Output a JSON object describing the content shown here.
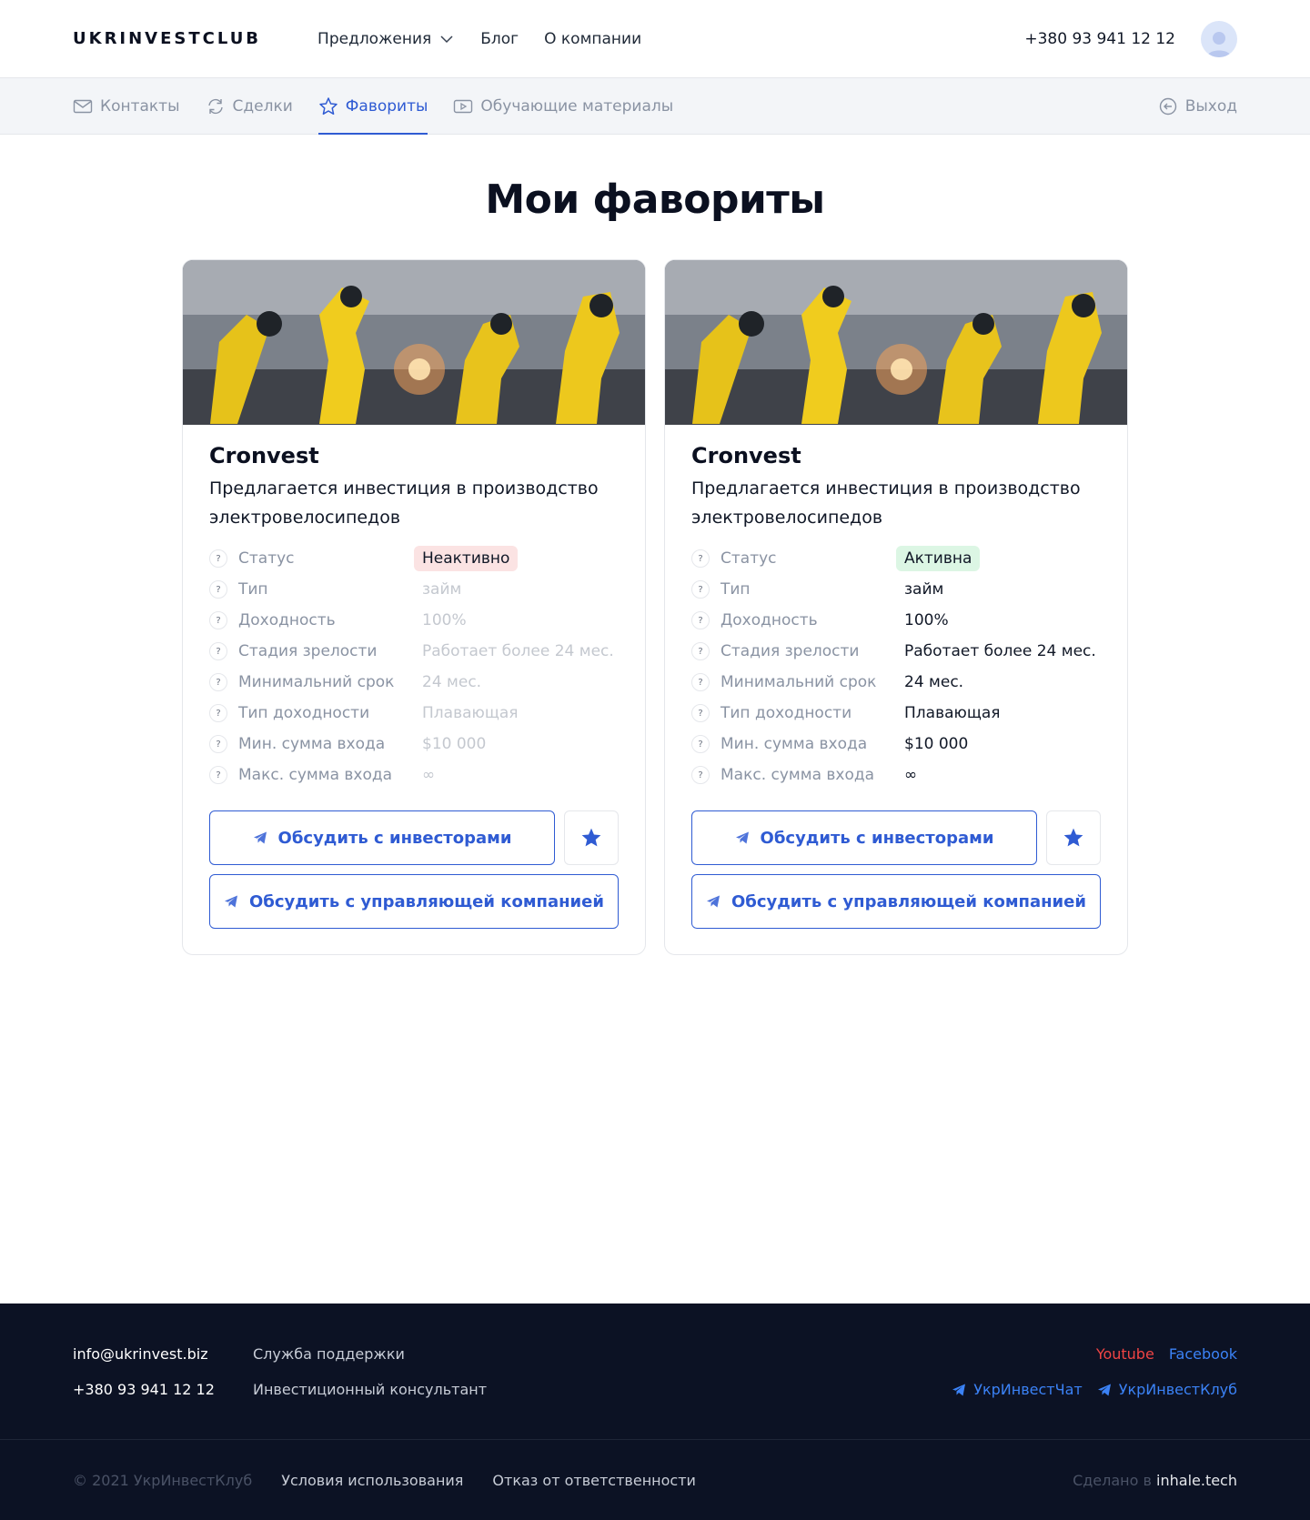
{
  "header": {
    "logo": "UKRINVESTCLUB",
    "nav": [
      {
        "label": "Предложения",
        "has_dropdown": true
      },
      {
        "label": "Блог"
      },
      {
        "label": "О компании"
      }
    ],
    "phone": "+380 93 941 12 12"
  },
  "subnav": {
    "items": [
      {
        "label": "Контакты",
        "icon": "mail-icon"
      },
      {
        "label": "Сделки",
        "icon": "refresh-icon"
      },
      {
        "label": "Фавориты",
        "icon": "star-icon",
        "active": true
      },
      {
        "label": "Обучающие материалы",
        "icon": "video-icon"
      }
    ],
    "logout": "Выход"
  },
  "page_title": "Мои фавориты",
  "labels": {
    "status": "Статус",
    "type": "Тип",
    "yield": "Доходность",
    "maturity": "Стадия зрелости",
    "min_term": "Минимальний срок",
    "yield_type": "Тип доходности",
    "min_entry": "Мин. сумма входа",
    "max_entry": "Макс. сумма входа",
    "q": "?"
  },
  "buttons": {
    "discuss_investors": "Обсудить с инвесторами",
    "discuss_company": "Обсудить с управляющей компанией"
  },
  "cards": [
    {
      "name": "Cronvest",
      "description": "Предлагается инвестиция в производство электровелосипедов",
      "status": "Неактивно",
      "status_kind": "inactive",
      "type": "займ",
      "yield": "100%",
      "maturity": "Работает более 24 мес.",
      "min_term": "24 мес.",
      "yield_type": "Плавающая",
      "min_entry": "$10 000",
      "max_entry": "∞"
    },
    {
      "name": "Cronvest",
      "description": "Предлагается инвестиция в производство электровелосипедов",
      "status": "Активна",
      "status_kind": "active",
      "type": "займ",
      "yield": "100%",
      "maturity": "Работает более 24 мес.",
      "min_term": "24 мес.",
      "yield_type": "Плавающая",
      "min_entry": "$10 000",
      "max_entry": "∞"
    }
  ],
  "footer": {
    "email": "info@ukrinvest.biz",
    "phone": "+380 93 941 12 12",
    "support": "Служба поддержки",
    "consultant": "Инвестиционный консультант",
    "youtube": "Youtube",
    "facebook": "Facebook",
    "chat": "УкрИнвестЧат",
    "club": "УкрИнвестКлуб",
    "copyright": "© 2021 УкрИнвестКлуб",
    "terms": "Условия использования",
    "disclaimer": "Отказ от ответственности",
    "made_by": "Сделано в",
    "made_by_link": "inhale.tech"
  },
  "colors": {
    "accent": "#2f5bd3",
    "footer_bg": "#0c1224",
    "inactive_badge": "#fbe3e3",
    "active_badge": "#dcf6e4",
    "youtube": "#ef4444",
    "link": "#3b82f6"
  }
}
